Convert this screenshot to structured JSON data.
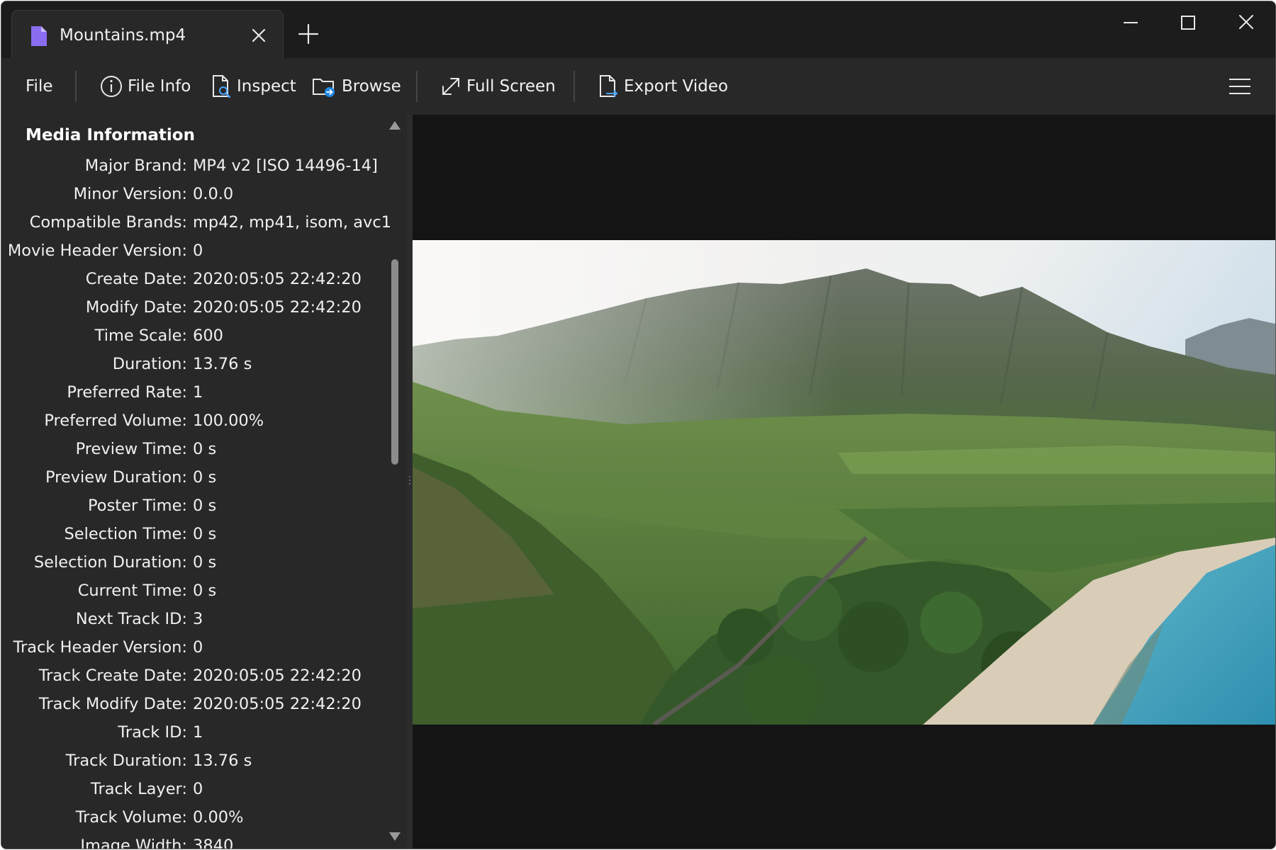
{
  "tab": {
    "title": "Mountains.mp4",
    "icon": "file-icon",
    "icon_color": "#8a6cf0"
  },
  "toolbar": {
    "file": "File",
    "file_info": "File Info",
    "inspect": "Inspect",
    "browse": "Browse",
    "full_screen": "Full Screen",
    "export_video": "Export Video"
  },
  "info": {
    "heading": "Media Information",
    "rows": [
      {
        "label": "Major Brand:",
        "value": "MP4 v2 [ISO 14496-14]"
      },
      {
        "label": "Minor Version:",
        "value": "0.0.0"
      },
      {
        "label": "Compatible Brands:",
        "value": "mp42, mp41, isom, avc1"
      },
      {
        "label": "Movie Header Version:",
        "value": "0"
      },
      {
        "label": "Create Date:",
        "value": "2020:05:05 22:42:20"
      },
      {
        "label": "Modify Date:",
        "value": "2020:05:05 22:42:20"
      },
      {
        "label": "Time Scale:",
        "value": "600"
      },
      {
        "label": "Duration:",
        "value": "13.76 s"
      },
      {
        "label": "Preferred Rate:",
        "value": "1"
      },
      {
        "label": "Preferred Volume:",
        "value": "100.00%"
      },
      {
        "label": "Preview Time:",
        "value": "0 s"
      },
      {
        "label": "Preview Duration:",
        "value": "0 s"
      },
      {
        "label": "Poster Time:",
        "value": "0 s"
      },
      {
        "label": "Selection Time:",
        "value": "0 s"
      },
      {
        "label": "Selection Duration:",
        "value": "0 s"
      },
      {
        "label": "Current Time:",
        "value": "0 s"
      },
      {
        "label": "Next Track ID:",
        "value": "3"
      },
      {
        "label": "Track Header Version:",
        "value": "0"
      },
      {
        "label": "Track Create Date:",
        "value": "2020:05:05 22:42:20"
      },
      {
        "label": "Track Modify Date:",
        "value": "2020:05:05 22:42:20"
      },
      {
        "label": "Track ID:",
        "value": "1"
      },
      {
        "label": "Track Duration:",
        "value": "13.76 s"
      },
      {
        "label": "Track Layer:",
        "value": "0"
      },
      {
        "label": "Track Volume:",
        "value": "0.00%"
      },
      {
        "label": "Image Width:",
        "value": "3840"
      }
    ]
  },
  "colors": {
    "accent": "#8a6cf0",
    "browse_badge": "#1e88e5",
    "panel_bg": "#282828",
    "video_bg": "#141414"
  }
}
